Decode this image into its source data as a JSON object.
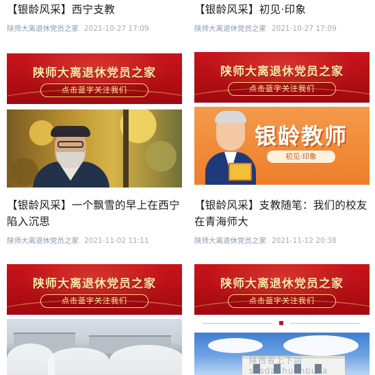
{
  "articles": [
    {
      "title": "【银龄风采】西宁支教",
      "author": "陕师大离退休党员之家",
      "date": "2021-10-27 17:09"
    },
    {
      "title": "【银龄风采】初见·印象",
      "author": "陕师大离退休党员之家",
      "date": "2021-10-27 17:09"
    },
    {
      "title": "【银龄风采】一个飘雪的早上在西宁陷入沉思",
      "author": "陕师大离退休党员之家",
      "date": "2021-11-02 11:11",
      "banner_title": "陕师大离退休党员之家",
      "banner_button": "点击蓝字关注我们"
    },
    {
      "title": "【银龄风采】支教随笔：我们的校友在青海师大",
      "author": "陕师大离退休党员之家",
      "date": "2021-11-12 20:38",
      "banner_title": "陕师大离退休党员之家",
      "banner_button": "点击蓝字关注我们",
      "cover_title": "银龄教师",
      "cover_subtitle": "初见·印象"
    },
    {
      "banner_title": "陕师大离退休党员之家",
      "banner_button": "点击蓝字关注我们"
    },
    {
      "banner_title": "陕师大离退休党员之家",
      "banner_button": "点击蓝字关注我们"
    }
  ],
  "watermark": "陕西省上下站 sxsdanhuanbuza"
}
